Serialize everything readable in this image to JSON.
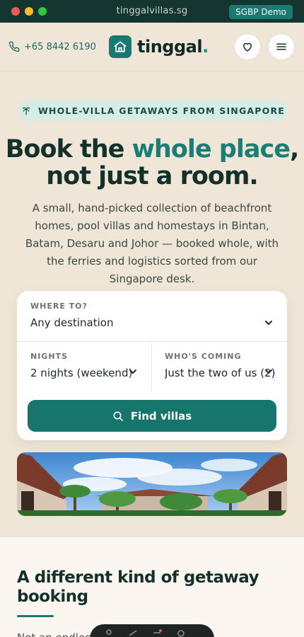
{
  "browser": {
    "url": "tinggalvillas.sg",
    "badge": "SGBP Demo"
  },
  "header": {
    "phone": "+65 8442 6190",
    "logo_text": "tinggal",
    "logo_dot": "."
  },
  "hero": {
    "pill": "WHOLE-VILLA GETAWAYS FROM SINGAPORE",
    "headline_part1": "Book the ",
    "headline_accent": "whole place",
    "headline_part2": ",",
    "headline_line2": "not just a room.",
    "subtext": "A small, hand-picked collection of beachfront homes, pool villas and homestays in Bintan, Batam, Desaru and Johor — booked whole, with the ferries and logistics sorted from our Singapore desk."
  },
  "search": {
    "where_label": "WHERE TO?",
    "where_value": "Any destination",
    "nights_label": "NIGHTS",
    "nights_value": "2 nights (weekend)",
    "who_label": "WHO'S COMING",
    "who_value": "Just the two of us (2)",
    "button": "Find villas"
  },
  "section": {
    "title": "A different kind of getaway booking",
    "text": "Not an endless ... collection of"
  },
  "colors": {
    "accent": "#1a7a72",
    "background": "#efe6d8",
    "chrome": "#143530"
  }
}
